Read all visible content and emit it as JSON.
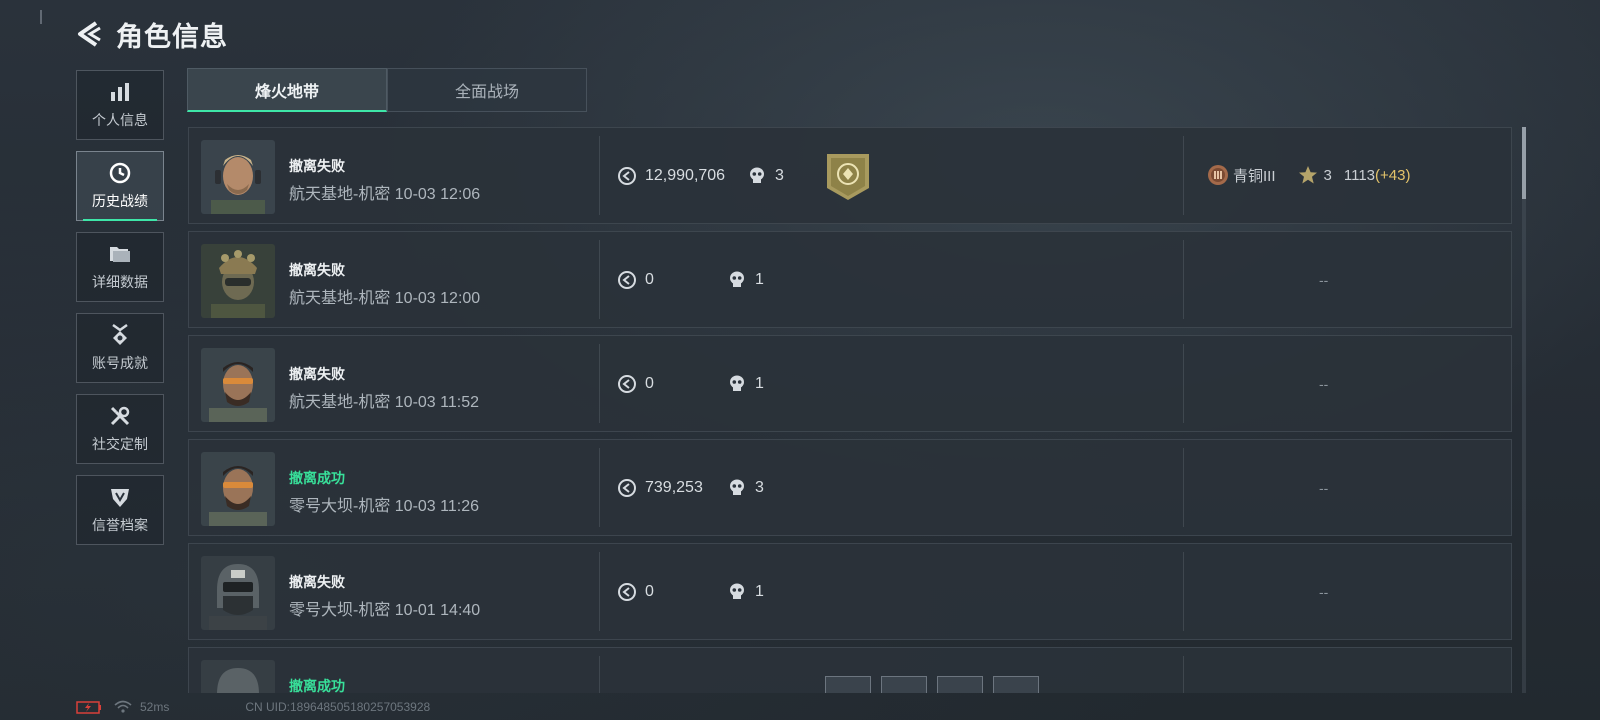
{
  "header": {
    "title": "角色信息"
  },
  "sidebar": {
    "items": [
      {
        "label": "个人信息",
        "icon": "bar-chart-icon",
        "active": false
      },
      {
        "label": "历史战绩",
        "icon": "clock-icon",
        "active": true
      },
      {
        "label": "详细数据",
        "icon": "folder-icon",
        "active": false
      },
      {
        "label": "账号成就",
        "icon": "achievement-icon",
        "active": false
      },
      {
        "label": "社交定制",
        "icon": "tools-icon",
        "active": false
      },
      {
        "label": "信誉档案",
        "icon": "shield-icon",
        "active": false
      }
    ]
  },
  "tabs": [
    {
      "label": "烽火地带",
      "active": true
    },
    {
      "label": "全面战场",
      "active": false
    }
  ],
  "matches": [
    {
      "status": "撤离失败",
      "success": false,
      "meta": "航天基地-机密 10-03 12:06",
      "value": "12,990,706",
      "kills": "3",
      "badge": true,
      "rank_name": "青铜III",
      "rank_stars": "3",
      "rank_score": "1113",
      "rank_gain": "(+43)",
      "rank_dash": ""
    },
    {
      "status": "撤离失败",
      "success": false,
      "meta": "航天基地-机密 10-03 12:00",
      "value": "0",
      "kills": "1",
      "badge": false,
      "rank_dash": "--"
    },
    {
      "status": "撤离失败",
      "success": false,
      "meta": "航天基地-机密 10-03 11:52",
      "value": "0",
      "kills": "1",
      "badge": false,
      "rank_dash": "--"
    },
    {
      "status": "撤离成功",
      "success": true,
      "meta": "零号大坝-机密 10-03 11:26",
      "value": "739,253",
      "kills": "3",
      "badge": false,
      "rank_dash": "--"
    },
    {
      "status": "撤离失败",
      "success": false,
      "meta": "零号大坝-机密 10-01 14:40",
      "value": "0",
      "kills": "1",
      "badge": false,
      "rank_dash": "--"
    },
    {
      "status": "撤离成功",
      "success": true,
      "meta": "",
      "value": "",
      "kills": "",
      "badge": false,
      "rank_dash": ""
    }
  ],
  "footer": {
    "ping": "52ms",
    "uid": "CN UID:189648505180257053928"
  },
  "colors": {
    "accent": "#3ee6a8",
    "success": "#38e09a",
    "gain": "#e3c36a"
  }
}
